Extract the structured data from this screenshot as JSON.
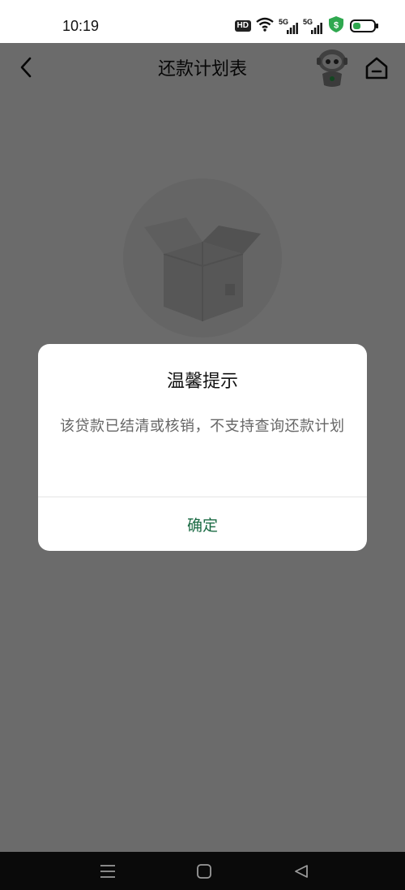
{
  "status_bar": {
    "time": "10:19",
    "hd_label": "HD",
    "sim1_label": "5G",
    "sim2_label": "5G",
    "battery_level": 0.35,
    "shield_color": "#2fa84f"
  },
  "navbar": {
    "title": "还款计划表",
    "back_icon": "chevron-left-icon",
    "assistant_icon": "robot-assistant-icon",
    "home_icon": "home-icon"
  },
  "empty_state": {
    "icon": "empty-box-icon"
  },
  "dialog": {
    "title": "温馨提示",
    "message": "该贷款已结清或核销，不支持查询还款计划",
    "confirm_label": "确定",
    "accent_color": "#1b6b44"
  },
  "system_nav": {
    "menu_icon": "menu-icon",
    "home_icon": "square-home-icon",
    "back_icon": "triangle-back-icon"
  }
}
